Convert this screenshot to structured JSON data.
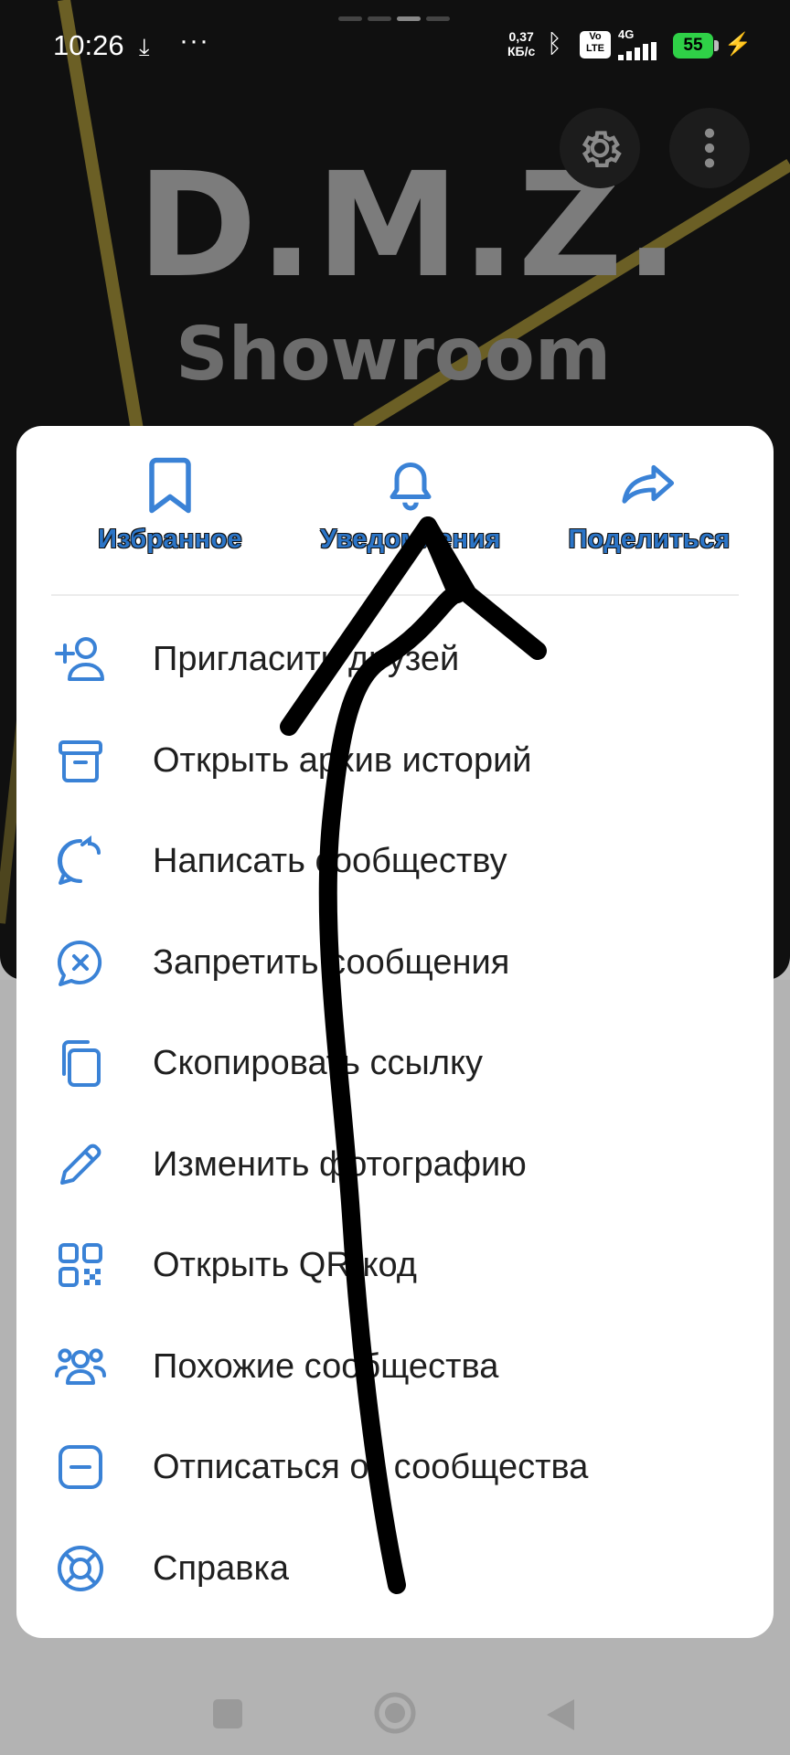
{
  "cover": {
    "logo_line1": "D.M.Z.",
    "logo_line2": "Showroom"
  },
  "status_bar": {
    "time": "10:26",
    "download_icon": "download-icon",
    "more": "···",
    "speed_value": "0,37",
    "speed_unit": "КБ/с",
    "volte": "Vo LTE",
    "network": "4G",
    "battery": "55",
    "colors": {
      "battery": "#2fd147"
    }
  },
  "sheet": {
    "top_actions": [
      {
        "label": "Избранное",
        "icon": "bookmark-icon"
      },
      {
        "label": "Уведомления",
        "icon": "bell-icon"
      },
      {
        "label": "Поделиться",
        "icon": "share-icon"
      }
    ],
    "items": [
      {
        "label": "Пригласить друзей",
        "icon": "add-user-icon"
      },
      {
        "label": "Открыть архив историй",
        "icon": "archive-icon"
      },
      {
        "label": "Написать сообществу",
        "icon": "chat-reply-icon"
      },
      {
        "label": "Запретить сообщения",
        "icon": "chat-block-icon"
      },
      {
        "label": "Скопировать ссылку",
        "icon": "copy-icon"
      },
      {
        "label": "Изменить фотографию",
        "icon": "pencil-icon"
      },
      {
        "label": "Открыть QR-код",
        "icon": "qr-code-icon"
      },
      {
        "label": "Похожие сообщества",
        "icon": "group-icon"
      },
      {
        "label": "Отписаться от сообщества",
        "icon": "unsubscribe-icon"
      },
      {
        "label": "Справка",
        "icon": "help-lifebuoy-icon"
      }
    ],
    "colors": {
      "accent": "#3a82d6",
      "text": "#1f1f1f"
    }
  },
  "navbar": {
    "icons": [
      "recents-icon",
      "home-icon",
      "back-icon"
    ]
  }
}
